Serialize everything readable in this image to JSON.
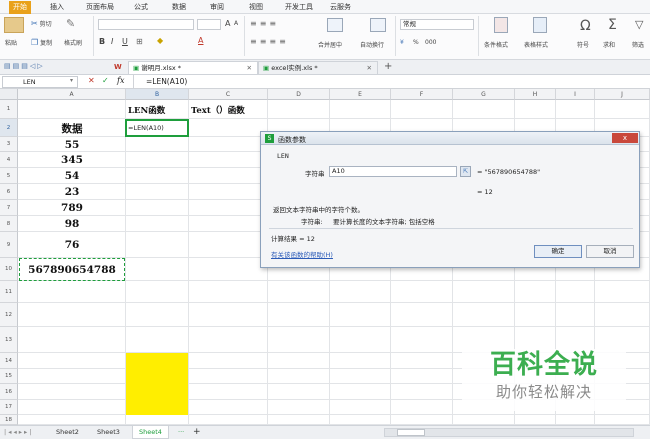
{
  "menu": {
    "items": [
      "开始",
      "插入",
      "页面布局",
      "公式",
      "数据",
      "审阅",
      "视图",
      "开发工具",
      "云服务"
    ]
  },
  "ribbon": {
    "paste": "粘贴",
    "cut": "剪切",
    "copy": "复制",
    "format_painter": "格式刷",
    "bold": "B",
    "italic": "I",
    "underline": "U",
    "font_grow": "A",
    "font_shrink": "A",
    "merge": "合并居中",
    "wrap": "自动换行",
    "number_format": "常规",
    "percent": "%",
    "thousands": "000",
    "cond_format": "条件格式",
    "table_style": "表格样式",
    "symbol_icon": "Ω",
    "symbol": "符号",
    "sum_icon": "Σ",
    "sum": "求和",
    "filter": "筛选"
  },
  "tabs": {
    "book1": "谢明月.xlsx *",
    "book2": "excel实例.xls *",
    "new": "+"
  },
  "formula_bar": {
    "name_box": "LEN",
    "cancel": "✕",
    "confirm": "✓",
    "fx": "fx",
    "formula": "=LEN(A10)"
  },
  "columns": [
    "A",
    "B",
    "C",
    "D",
    "E",
    "F",
    "G",
    "H",
    "I",
    "J"
  ],
  "rows": [
    "1",
    "2",
    "3",
    "4",
    "5",
    "6",
    "7",
    "8",
    "9",
    "10",
    "11",
    "12",
    "13",
    "14",
    "15",
    "16",
    "17",
    "18"
  ],
  "cells": {
    "b1": "LEN函数",
    "c1": "Text（）函数",
    "a2": "数据",
    "b2": "=LEN(A10)",
    "a3": "55",
    "a4": "345",
    "a5": "54",
    "a6": "23",
    "a7": "789",
    "a8": "98",
    "a9": "76",
    "a10": "567890654788"
  },
  "colors": {
    "highlight": "#ffee00",
    "accent": "#e9a11b",
    "selection": "#1e9e3c"
  },
  "dialog": {
    "title": "函数参数",
    "close": "x",
    "func_name": "LEN",
    "arg_label": "字符串",
    "arg_value": "A10",
    "arg_result": "= \"567890654788\"",
    "total": "= 12",
    "desc": "返回文本字符串中的字符个数。",
    "arg_desc_label": "字符串:",
    "arg_desc": "要计算长度的文本字符串; 包括空格",
    "calc_result": "计算结果 = 12",
    "help": "有关该函数的帮助(H)",
    "ok": "确定",
    "cancel": "取消"
  },
  "sheets": {
    "s2": "Sheet2",
    "s3": "Sheet3",
    "s4": "Sheet4",
    "more": "···",
    "add": "+"
  },
  "watermark": {
    "title": "百科全说",
    "subtitle": "助你轻松解决"
  }
}
